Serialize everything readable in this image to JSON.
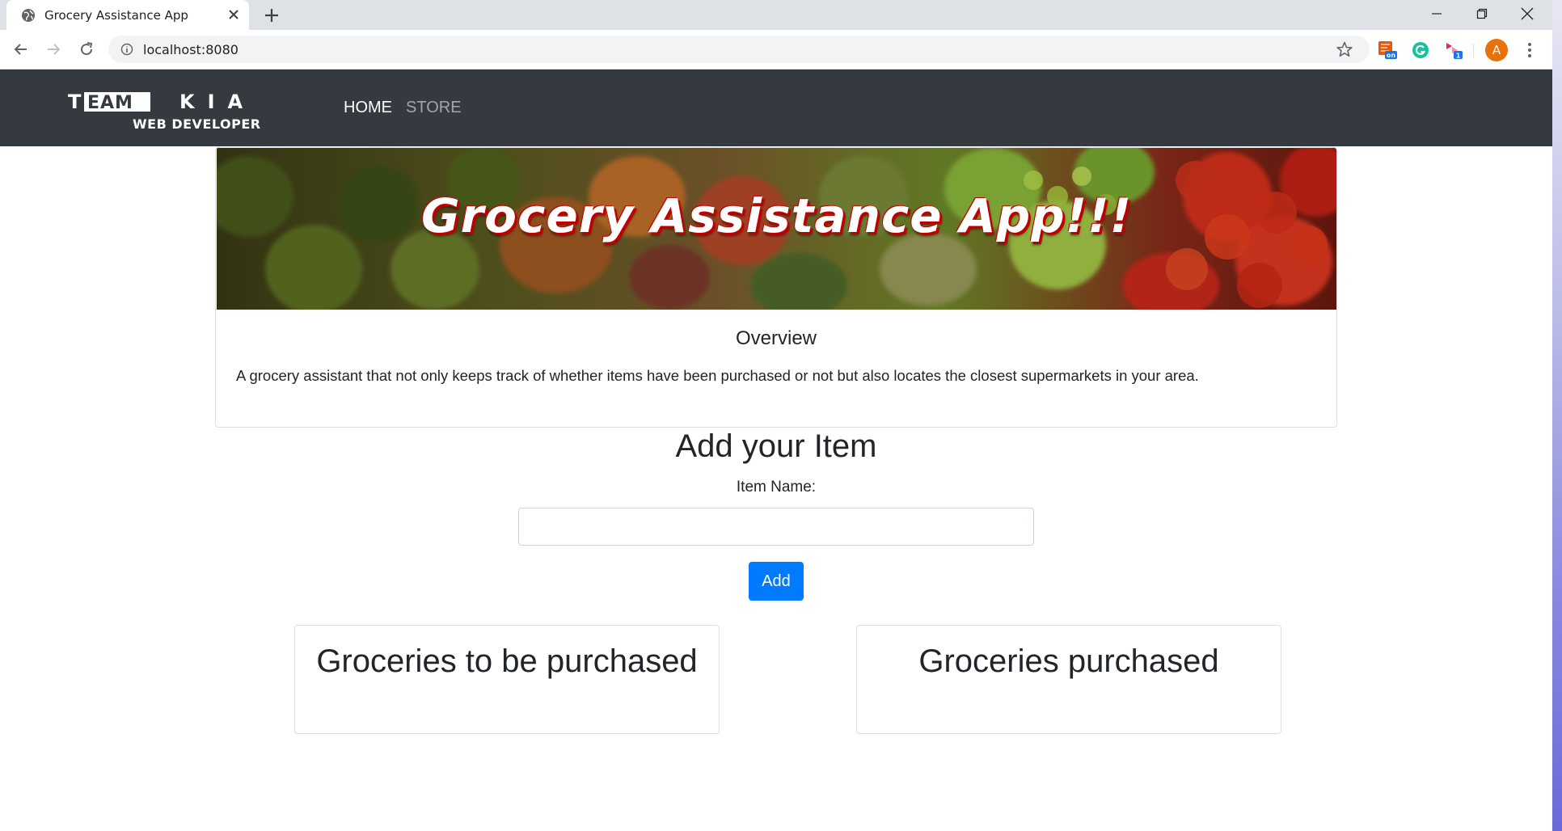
{
  "browser": {
    "tab_title": "Grocery Assistance App",
    "url": "localhost:8080",
    "avatar_letter": "A",
    "icons": [
      "globe-icon",
      "close-icon",
      "plus-icon",
      "minimize-icon",
      "restore-icon",
      "back-icon",
      "forward-icon",
      "reload-icon",
      "info-icon",
      "star-icon",
      "kebab-menu-icon"
    ],
    "extensions": [
      "extension-on-icon",
      "grammarly-icon",
      "extension-badge-icon"
    ]
  },
  "navbar": {
    "brand_top": "TEAM KIA",
    "brand_bottom": "WEB DEVELOPER",
    "links": [
      {
        "label": "HOME",
        "active": true
      },
      {
        "label": "STORE",
        "active": false
      }
    ],
    "bg_color": "#343a40"
  },
  "hero": {
    "title": "Grocery Assistance App!!!",
    "overview_heading": "Overview",
    "overview_text": "A grocery assistant that not only keeps track of whether items have been purchased or not but also locates the closest supermarkets in your area."
  },
  "form": {
    "heading": "Add your Item",
    "label": "Item Name:",
    "value": "",
    "button_label": "Add",
    "button_color": "#007bff"
  },
  "lists": {
    "to_purchase_title": "Groceries to be purchased",
    "purchased_title": "Groceries purchased"
  }
}
